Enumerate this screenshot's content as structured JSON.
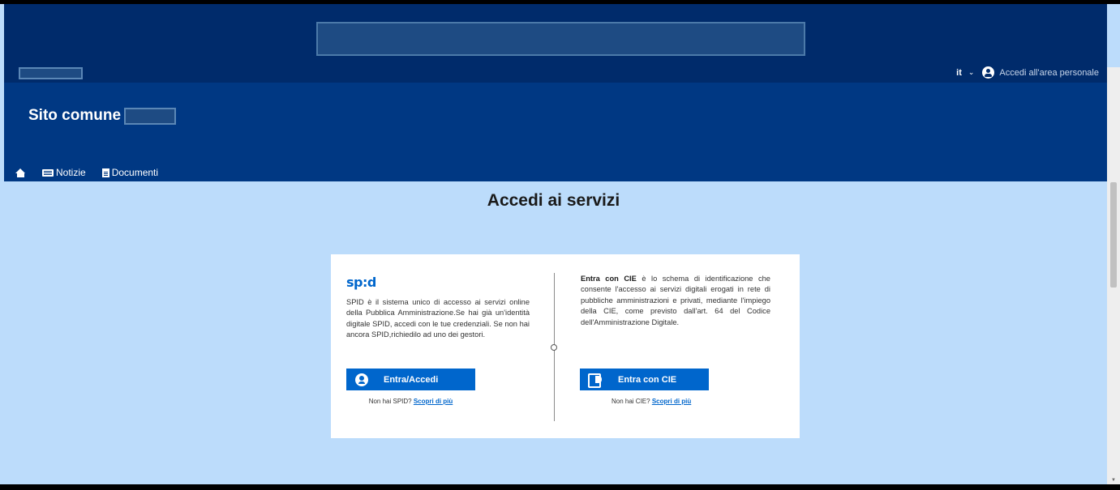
{
  "header": {
    "language": "it",
    "personal_area_label": "Accedi all'area personale"
  },
  "site": {
    "title": "Sito comune"
  },
  "nav": {
    "items": [
      {
        "label": "",
        "icon": "home-icon"
      },
      {
        "label": "Notizie",
        "icon": "news-icon"
      },
      {
        "label": "Documenti",
        "icon": "document-icon"
      }
    ]
  },
  "main": {
    "title": "Accedi ai servizi"
  },
  "spid": {
    "logo": "sp:d",
    "description": "SPID è il sistema unico di accesso ai servizi online della Pubblica Amministrazione.Se hai già un'identità digitale SPID, accedi con le tue credenziali. Se non hai ancora SPID,richiedilo ad uno dei gestori.",
    "button_label": "Entra/Accedi",
    "help_prefix": "Non hai SPID?",
    "help_link": "Scopri di più"
  },
  "cie": {
    "title_bold": "Entra con CIE",
    "description": " è lo schema di identificazione che consente l'accesso ai servizi digitali erogati in rete di pubbliche amministrazioni e privati, mediante l'impiego della CIE, come previsto dall'art. 64 del Codice dell'Amministrazione Digitale.",
    "button_label": "Entra con CIE",
    "help_prefix": "Non hai CIE?",
    "help_link": "Scopri di più"
  },
  "colors": {
    "top_header": "#002b6b",
    "main_header": "#003883",
    "page_background": "#bcdcfb",
    "accent": "#0066cc"
  }
}
